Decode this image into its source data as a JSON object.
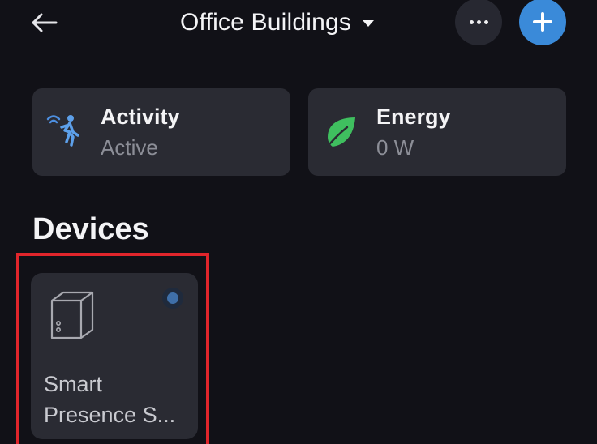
{
  "header": {
    "title": "Office Buildings",
    "back_icon": "arrow-left-icon",
    "more_icon": "ellipsis-icon",
    "add_icon": "plus-icon"
  },
  "summary": {
    "activity": {
      "title": "Activity",
      "value": "Active",
      "icon": "motion-sensor-person-icon"
    },
    "energy": {
      "title": "Energy",
      "value": "0 W",
      "icon": "leaf-icon"
    }
  },
  "devices": {
    "section_title": "Devices",
    "items": [
      {
        "name": "Smart Presence S...",
        "icon": "presence-sensor-device-icon",
        "status": "connected"
      }
    ]
  },
  "colors": {
    "background": "#111117",
    "card": "#2a2b33",
    "accent": "#3a8ad9",
    "energy_green": "#3fbf5f",
    "highlight": "#e0252b"
  }
}
